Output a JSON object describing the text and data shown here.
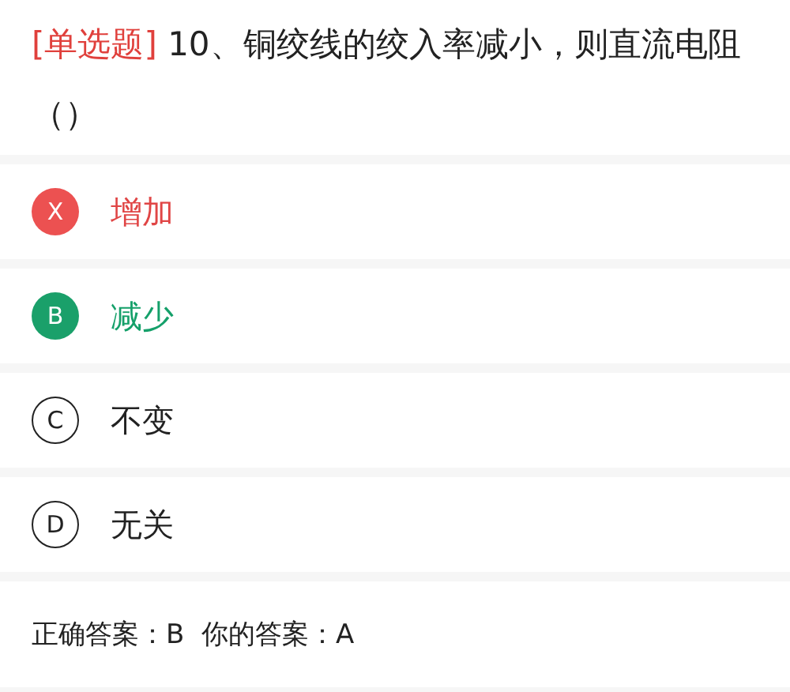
{
  "question": {
    "type_tag": "[单选题]",
    "text": "10、铜绞线的绞入率减小，则直流电阻（）"
  },
  "options": [
    {
      "letter": "X",
      "text": "增加",
      "kind": "wrong"
    },
    {
      "letter": "B",
      "text": "减少",
      "kind": "correct"
    },
    {
      "letter": "C",
      "text": "不变",
      "kind": "plain"
    },
    {
      "letter": "D",
      "text": "无关",
      "kind": "plain"
    }
  ],
  "answer_line": "正确答案：B  你的答案：A"
}
